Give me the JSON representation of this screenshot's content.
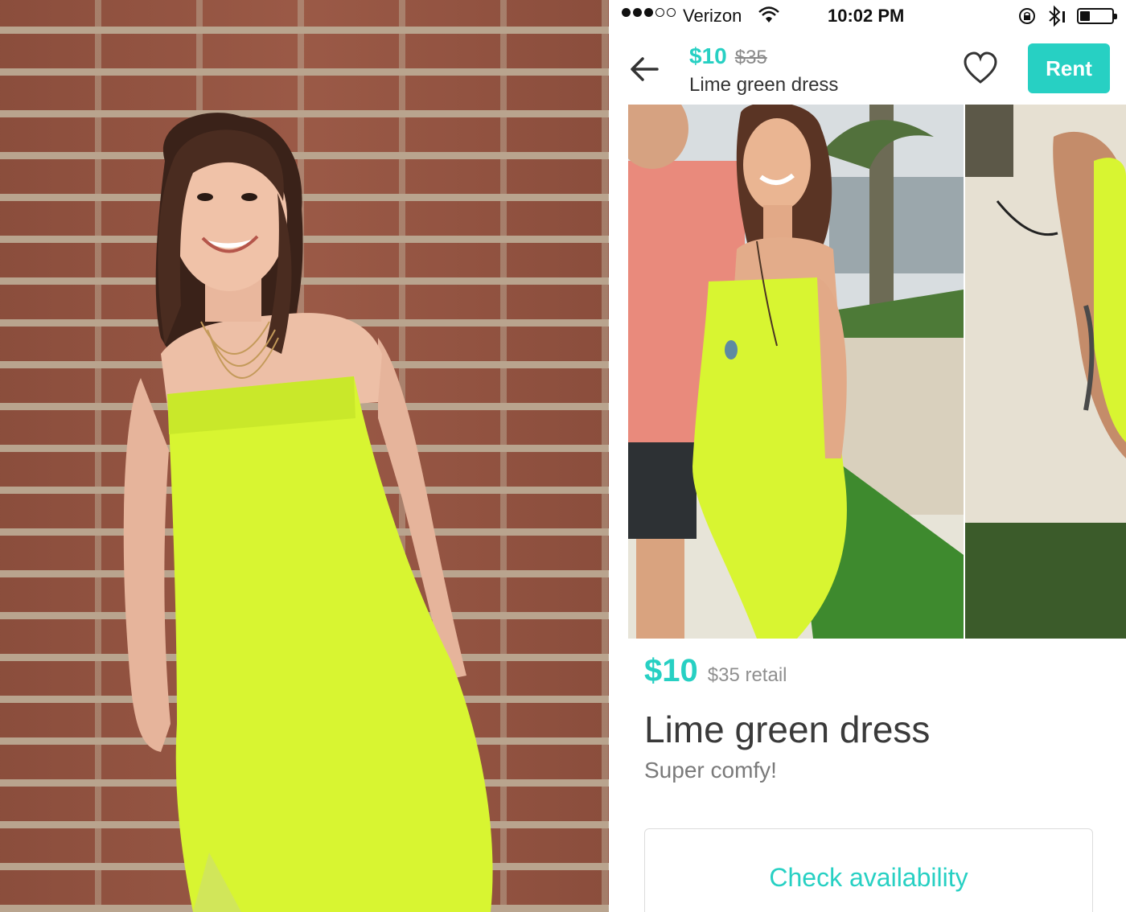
{
  "status_bar": {
    "carrier": "Verizon",
    "time": "10:02 PM",
    "signal_bars_filled": 3,
    "signal_bars_total": 5
  },
  "header": {
    "price": "$10",
    "original_price": "$35",
    "title": "Lime green dress",
    "rent_label": "Rent"
  },
  "listing": {
    "price": "$10",
    "retail": "$35 retail",
    "title": "Lime green dress",
    "description": "Super comfy!",
    "check_availability_label": "Check availability"
  },
  "colors": {
    "accent": "#27d0c3",
    "dress": "#d8f531",
    "brick": "#9b5a47"
  },
  "icons": [
    "back-arrow-icon",
    "heart-icon",
    "wifi-icon",
    "lock-rotation-icon",
    "bluetooth-icon",
    "battery-icon"
  ]
}
